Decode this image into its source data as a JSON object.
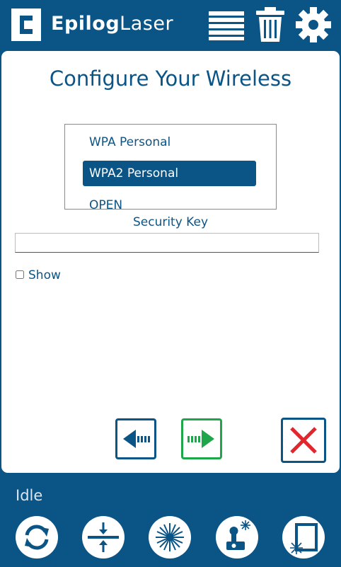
{
  "header": {
    "brand_bold": "Epilog",
    "brand_light": "Laser",
    "icons": [
      "job-list-icon",
      "trash-icon",
      "gear-icon"
    ]
  },
  "dialog": {
    "title": "Configure Your Wireless",
    "security_options": [
      {
        "label": "WPA Personal",
        "selected": false
      },
      {
        "label": "WPA2 Personal",
        "selected": true
      },
      {
        "label": "OPEN",
        "selected": false
      }
    ],
    "security_key_label": "Security Key",
    "security_key_value": "",
    "show_label": "Show",
    "show_checked": false,
    "buttons": [
      "back-arrow-icon",
      "next-arrow-icon",
      "close-x-icon"
    ]
  },
  "status": {
    "text": "Idle",
    "buttons": [
      "refresh-icon",
      "focus-icon",
      "laser-burst-icon",
      "joystick-icon",
      "frame-icon"
    ]
  },
  "colors": {
    "brand_blue": "#0b5486",
    "next_green": "#1fa64a",
    "cancel_red": "#e1262d"
  }
}
